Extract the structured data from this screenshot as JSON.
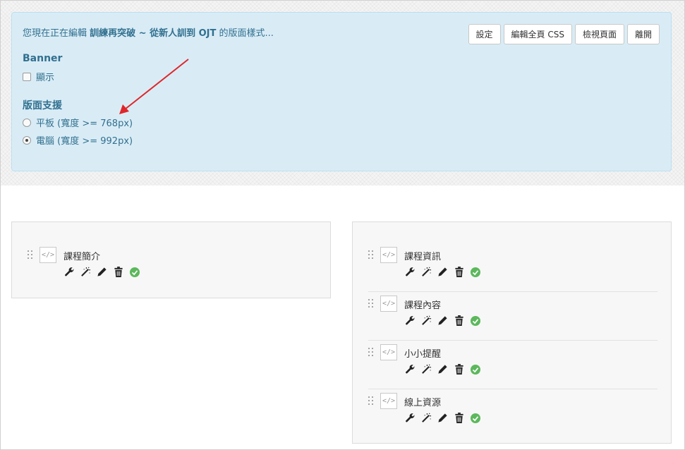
{
  "notice": {
    "prefix": "您現在正在編輯 ",
    "course_name": "訓練再突破 ~ 從新人訓到 OJT",
    "suffix": " 的版面樣式..."
  },
  "toolbar": {
    "settings": "設定",
    "edit_css": "編輯全頁 CSS",
    "view_page": "檢視頁面",
    "leave": "離開"
  },
  "banner": {
    "title": "Banner",
    "show_label": "顯示",
    "show_checked": false
  },
  "layout_support": {
    "title": "版面支援",
    "options": [
      {
        "label": "平板 (寬度 >= 768px)",
        "selected": false
      },
      {
        "label": "電腦 (寬度 >= 992px)",
        "selected": true
      }
    ]
  },
  "code_icon": "</>",
  "left_column": {
    "widgets": [
      {
        "name": "課程簡介"
      }
    ]
  },
  "right_column": {
    "widgets": [
      {
        "name": "課程資訊"
      },
      {
        "name": "課程內容"
      },
      {
        "name": "小小提醒"
      },
      {
        "name": "線上資源"
      }
    ]
  },
  "widget_tools": [
    "wrench-icon",
    "magic-wand-icon",
    "pencil-icon",
    "trash-icon",
    "check-circle-icon"
  ],
  "colors": {
    "info_bg": "#d9ecf6",
    "info_text": "#31708f",
    "arrow": "#e0262b",
    "check": "#5cb85c"
  }
}
